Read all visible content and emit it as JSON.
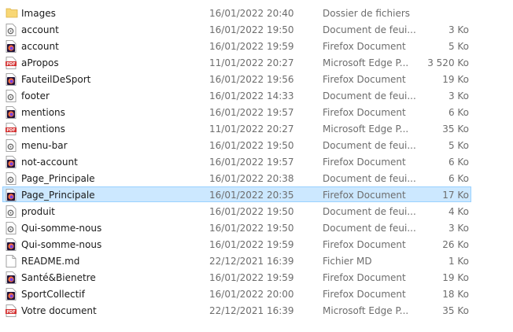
{
  "files": [
    {
      "name": "Images",
      "date": "16/01/2022 20:40",
      "type": "Dossier de fichiers",
      "size": "",
      "icon": "folder-icon",
      "selected": false
    },
    {
      "name": "account",
      "date": "16/01/2022 19:50",
      "type": "Document de feui...",
      "size": "3 Ko",
      "icon": "css-file-icon",
      "selected": false
    },
    {
      "name": "account",
      "date": "16/01/2022 19:59",
      "type": "Firefox Document",
      "size": "5 Ko",
      "icon": "firefox-html-icon",
      "selected": false
    },
    {
      "name": "aPropos",
      "date": "11/01/2022 20:27",
      "type": "Microsoft Edge P...",
      "size": "3 520 Ko",
      "icon": "pdf-icon",
      "selected": false
    },
    {
      "name": "FauteilDeSport",
      "date": "16/01/2022 19:56",
      "type": "Firefox Document",
      "size": "19 Ko",
      "icon": "firefox-html-icon",
      "selected": false
    },
    {
      "name": "footer",
      "date": "16/01/2022 14:33",
      "type": "Document de feui...",
      "size": "3 Ko",
      "icon": "css-file-icon",
      "selected": false
    },
    {
      "name": "mentions",
      "date": "16/01/2022 19:57",
      "type": "Firefox Document",
      "size": "6 Ko",
      "icon": "firefox-html-icon",
      "selected": false
    },
    {
      "name": "mentions",
      "date": "11/01/2022 20:27",
      "type": "Microsoft Edge P...",
      "size": "35 Ko",
      "icon": "pdf-icon",
      "selected": false
    },
    {
      "name": "menu-bar",
      "date": "16/01/2022 19:50",
      "type": "Document de feui...",
      "size": "5 Ko",
      "icon": "css-file-icon",
      "selected": false
    },
    {
      "name": "not-account",
      "date": "16/01/2022 19:57",
      "type": "Firefox Document",
      "size": "6 Ko",
      "icon": "firefox-html-icon",
      "selected": false
    },
    {
      "name": "Page_Principale",
      "date": "16/01/2022 20:38",
      "type": "Document de feui...",
      "size": "6 Ko",
      "icon": "css-file-icon",
      "selected": false
    },
    {
      "name": "Page_Principale",
      "date": "16/01/2022 20:35",
      "type": "Firefox Document",
      "size": "17 Ko",
      "icon": "firefox-html-icon",
      "selected": true
    },
    {
      "name": "produit",
      "date": "16/01/2022 19:50",
      "type": "Document de feui...",
      "size": "4 Ko",
      "icon": "css-file-icon",
      "selected": false
    },
    {
      "name": "Qui-somme-nous",
      "date": "16/01/2022 19:50",
      "type": "Document de feui...",
      "size": "3 Ko",
      "icon": "css-file-icon",
      "selected": false
    },
    {
      "name": "Qui-somme-nous",
      "date": "16/01/2022 19:59",
      "type": "Firefox Document",
      "size": "26 Ko",
      "icon": "firefox-html-icon",
      "selected": false
    },
    {
      "name": "README.md",
      "date": "22/12/2021 16:39",
      "type": "Fichier MD",
      "size": "1 Ko",
      "icon": "text-file-icon",
      "selected": false
    },
    {
      "name": "Santé&Bienetre",
      "date": "16/01/2022 19:59",
      "type": "Firefox Document",
      "size": "19 Ko",
      "icon": "firefox-html-icon",
      "selected": false
    },
    {
      "name": "SportCollectif",
      "date": "16/01/2022 20:00",
      "type": "Firefox Document",
      "size": "18 Ko",
      "icon": "firefox-html-icon",
      "selected": false
    },
    {
      "name": "Votre document",
      "date": "22/12/2021 16:39",
      "type": "Microsoft Edge P...",
      "size": "35 Ko",
      "icon": "pdf-icon",
      "selected": false
    }
  ],
  "colors": {
    "selection_bg": "#cce8ff",
    "selection_border": "#99d1ff",
    "folder": "#f8d775",
    "pdf": "#d32f2f",
    "firefox_bg": "#20123a",
    "firefox_flame": "#ff7139"
  }
}
